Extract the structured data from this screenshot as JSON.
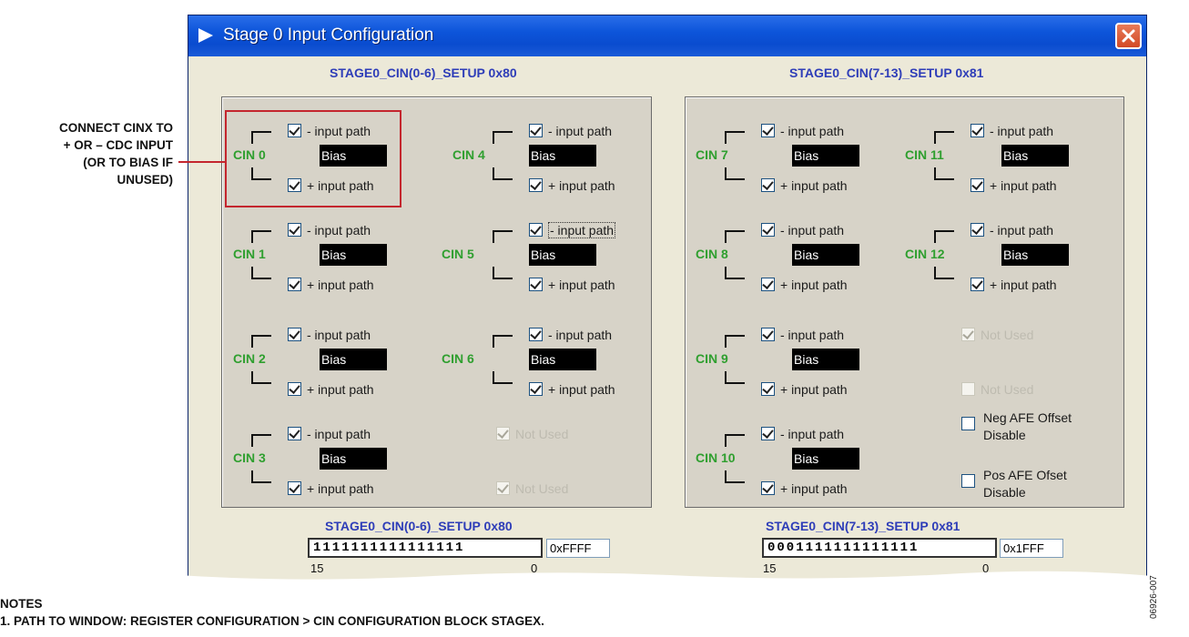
{
  "callout": {
    "lines": [
      "CONNECT CINX TO",
      "+ OR – CDC INPUT",
      "(OR TO BIAS IF",
      "UNUSED)"
    ]
  },
  "window": {
    "title": "Stage 0 Input Configuration"
  },
  "left_group": {
    "title": "STAGE0_CIN(0-6)_SETUP 0x80",
    "cins": [
      {
        "label": "CIN 0",
        "neg": "- input path",
        "pos": "+ input path",
        "value": "Bias"
      },
      {
        "label": "CIN 1",
        "neg": "- input path",
        "pos": "+ input path",
        "value": "Bias"
      },
      {
        "label": "CIN 2",
        "neg": "- input path",
        "pos": "+ input path",
        "value": "Bias"
      },
      {
        "label": "CIN 3",
        "neg": "- input path",
        "pos": "+ input path",
        "value": "Bias"
      },
      {
        "label": "CIN 4",
        "neg": "- input path",
        "pos": "+ input path",
        "value": "Bias"
      },
      {
        "label": "CIN 5",
        "neg": "- input path",
        "pos": "+ input path",
        "value": "Bias"
      },
      {
        "label": "CIN 6",
        "neg": "- input path",
        "pos": "+ input path",
        "value": "Bias"
      }
    ],
    "not_used": [
      "Not Used",
      "Not Used"
    ]
  },
  "right_group": {
    "title": "STAGE0_CIN(7-13)_SETUP 0x81",
    "cins": [
      {
        "label": "CIN 7",
        "neg": "- input path",
        "pos": "+ input path",
        "value": "Bias"
      },
      {
        "label": "CIN 8",
        "neg": "- input path",
        "pos": "+ input path",
        "value": "Bias"
      },
      {
        "label": "CIN 9",
        "neg": "- input path",
        "pos": "+ input path",
        "value": "Bias"
      },
      {
        "label": "CIN 10",
        "neg": "- input path",
        "pos": "+ input path",
        "value": "Bias"
      },
      {
        "label": "CIN 11",
        "neg": "- input path",
        "pos": "+ input path",
        "value": "Bias"
      },
      {
        "label": "CIN 12",
        "neg": "- input path",
        "pos": "+ input path",
        "value": "Bias"
      }
    ],
    "not_used": [
      "Not Used",
      "Not Used"
    ],
    "neg_afe": [
      "Neg AFE Offset",
      "Disable"
    ],
    "pos_afe": [
      "Pos AFE Ofset",
      "Disable"
    ]
  },
  "registers": [
    {
      "title": "STAGE0_CIN(0-6)_SETUP 0x80",
      "bits": "1111111111111111",
      "hex": "0xFFFF",
      "msb": "15",
      "lsb": "0"
    },
    {
      "title": "STAGE0_CIN(7-13)_SETUP 0x81",
      "bits": "0001111111111111",
      "hex": "0x1FFF",
      "msb": "15",
      "lsb": "0"
    }
  ],
  "notes": {
    "heading": "NOTES",
    "line1": "1. PATH TO WINDOW: REGISTER CONFIGURATION > CIN CONFIGURATION BLOCK STAGEX."
  },
  "figure_id": "06926-007",
  "colors": {
    "titlebar": "#0a4ccf",
    "window_bg": "#ece9d8",
    "group_bg": "#d7d3c8",
    "cin_label": "#2f9f2f",
    "section_title": "#2e3db8",
    "callout": "#c4262e"
  }
}
